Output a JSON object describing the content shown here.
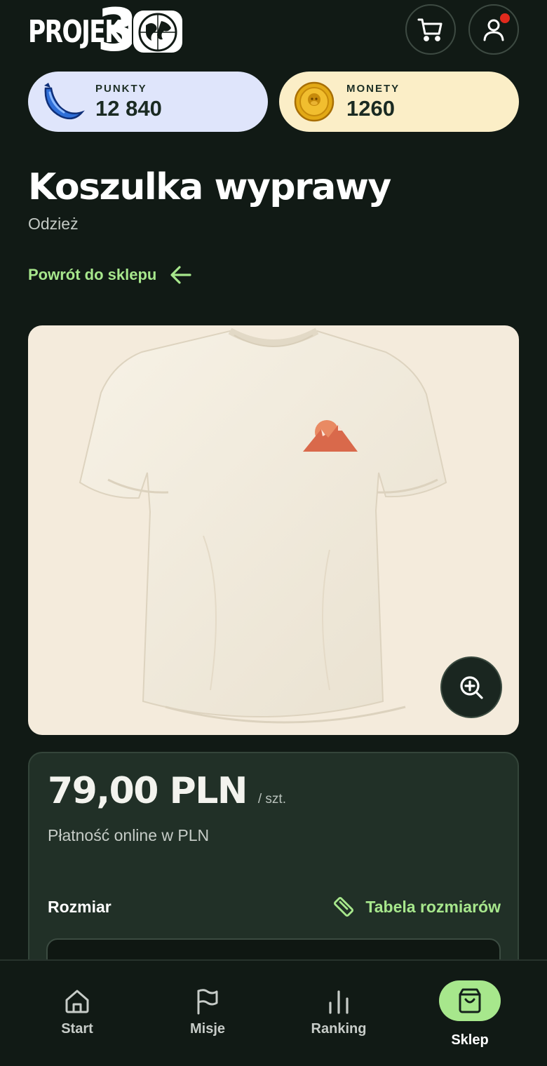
{
  "header": {
    "logo_text": "PROJEKT",
    "logo_number": "3",
    "cart_icon": "cart-icon",
    "user_icon": "user-icon",
    "notification": true
  },
  "balances": {
    "points": {
      "label": "PUNKTY",
      "value": "12 840",
      "icon": "banana-icon",
      "color": "#dfe5fb"
    },
    "coins": {
      "label": "MONETY",
      "value": "1260",
      "icon": "coin-icon",
      "color": "#fbeec7"
    }
  },
  "product": {
    "title": "Koszulka wyprawy",
    "category": "Odzież",
    "back_label": "Powrót do sklepu",
    "image": "tshirt-with-mountain-logo",
    "price": "79,00 PLN",
    "unit": "/ szt.",
    "payment_note": "Płatność online w PLN",
    "size_label": "Rozmiar",
    "size_table_label": "Tabela rozmiarów"
  },
  "nav": {
    "items": [
      {
        "label": "Start",
        "icon": "home-icon",
        "active": false
      },
      {
        "label": "Misje",
        "icon": "flag-icon",
        "active": false
      },
      {
        "label": "Ranking",
        "icon": "bar-chart-icon",
        "active": false
      },
      {
        "label": "Sklep",
        "icon": "shopping-bag-icon",
        "active": true
      }
    ]
  },
  "colors": {
    "background": "#111a15",
    "accent": "#a7e78c",
    "card": "#213027",
    "notification": "#e02a1d"
  }
}
